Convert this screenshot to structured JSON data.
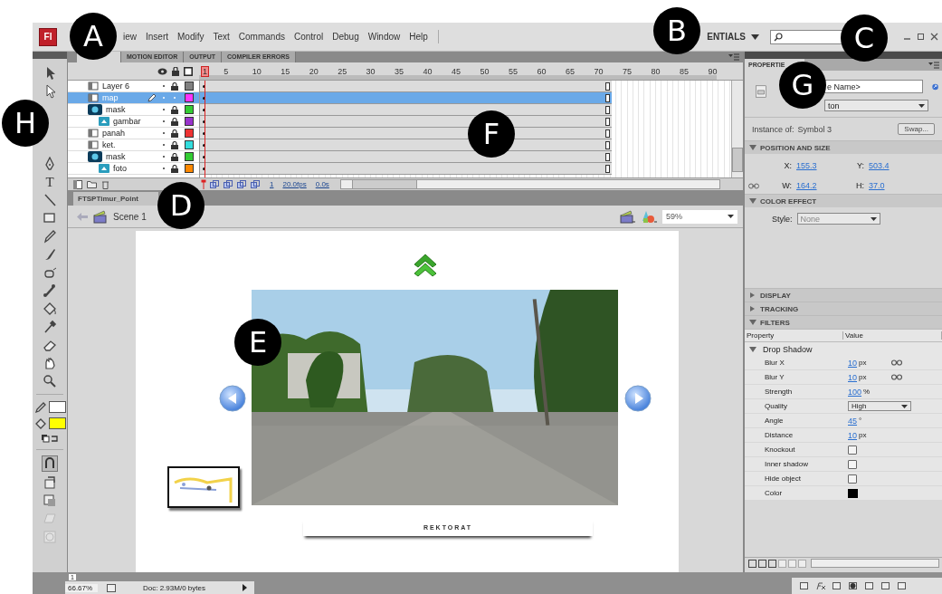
{
  "callouts": [
    "A",
    "B",
    "C",
    "D",
    "E",
    "F",
    "G",
    "H"
  ],
  "menu_bar": {
    "logo": "Fl",
    "items": [
      "iew",
      "Insert",
      "Modify",
      "Text",
      "Commands",
      "Control",
      "Debug",
      "Window",
      "Help"
    ],
    "workspace": "ENTIALS"
  },
  "tools": {
    "text_tool": "T",
    "swatches": [
      {
        "kind": "stroke",
        "color": "#ffffff"
      },
      {
        "kind": "fill",
        "color": "#ffff00"
      }
    ]
  },
  "timeline": {
    "tabs": [
      {
        "selected": true
      },
      {
        "label": "MOTION EDITOR",
        "selected": false
      },
      {
        "label": "OUTPUT",
        "selected": false
      },
      {
        "label": "COMPILER ERRORS",
        "selected": false
      }
    ],
    "ruler": [
      "1",
      "5",
      "10",
      "15",
      "20",
      "25",
      "30",
      "35",
      "40",
      "45",
      "50",
      "55",
      "60",
      "65",
      "70",
      "75",
      "80",
      "85",
      "90"
    ],
    "layers": [
      {
        "name": "Layer 6",
        "kind": "normal",
        "selected": false,
        "locked": true,
        "color": "#808080"
      },
      {
        "name": "map",
        "kind": "normal",
        "selected": true,
        "locked": false,
        "color": "#ff33ff"
      },
      {
        "name": "mask",
        "kind": "mask",
        "selected": false,
        "locked": true,
        "color": "#33cc33",
        "children": [
          {
            "name": "gambar",
            "kind": "masked",
            "selected": false,
            "locked": true,
            "color": "#9933cc"
          }
        ]
      },
      {
        "name": "panah",
        "kind": "normal",
        "selected": false,
        "locked": true,
        "color": "#ee3333"
      },
      {
        "name": "ket.",
        "kind": "normal",
        "selected": false,
        "locked": true,
        "color": "#33dddd"
      },
      {
        "name": "mask",
        "kind": "mask",
        "selected": false,
        "locked": true,
        "color": "#33cc33",
        "children": [
          {
            "name": "foto",
            "kind": "masked",
            "selected": false,
            "locked": true,
            "color": "#ff8800"
          }
        ]
      }
    ],
    "footer": {
      "frame": "1",
      "fps": "20.0fps",
      "time": "0.0s"
    }
  },
  "document": {
    "tab": "FTSPTimur_Point",
    "scene": "Scene 1",
    "zoom": "59%",
    "caption": "REKTORAT"
  },
  "properties": {
    "tab": "PROPERTIE",
    "instance_name": "e Name>",
    "behavior": "ton",
    "instance_of": "Instance of:",
    "symbol": "Symbol 3",
    "swap": "Swap...",
    "sections": [
      {
        "kind": "position",
        "title": "POSITION AND SIZE",
        "expanded": true,
        "fields": [
          {
            "label": "X:",
            "value": "155.3"
          },
          {
            "label": "Y:",
            "value": "503.4"
          },
          {
            "label": "W:",
            "value": "164.2"
          },
          {
            "label": "H:",
            "value": "37.0"
          }
        ]
      },
      {
        "kind": "color_effect",
        "title": "COLOR EFFECT",
        "expanded": true,
        "style_label": "Style:",
        "style": "None"
      },
      {
        "kind": "plain",
        "title": "DISPLAY",
        "expanded": false
      },
      {
        "kind": "plain",
        "title": "TRACKING",
        "expanded": false
      },
      {
        "kind": "filters",
        "title": "FILTERS",
        "expanded": true,
        "columns": [
          "Property",
          "Value"
        ],
        "filter": {
          "name": "Drop Shadow",
          "expanded": true,
          "rows": [
            {
              "kind": "number",
              "label": "Blur X",
              "value": "10",
              "unit": "px",
              "linked": true
            },
            {
              "kind": "number",
              "label": "Blur Y",
              "value": "10",
              "unit": "px",
              "linked": true
            },
            {
              "kind": "number",
              "label": "Strength",
              "value": "100",
              "unit": "%"
            },
            {
              "kind": "select",
              "label": "Quality",
              "value": "High"
            },
            {
              "kind": "number",
              "label": "Angle",
              "value": "45",
              "unit": "°"
            },
            {
              "kind": "number",
              "label": "Distance",
              "value": "10",
              "unit": "px"
            },
            {
              "kind": "check",
              "label": "Knockout",
              "checked": false
            },
            {
              "kind": "check",
              "label": "Inner shadow",
              "checked": false
            },
            {
              "kind": "check",
              "label": "Hide object",
              "checked": false
            },
            {
              "kind": "color",
              "label": "Color",
              "color": "#000000"
            }
          ]
        }
      }
    ]
  },
  "status_bar": {
    "frame": "1",
    "zoom": "66.67%",
    "doc": "Doc: 2.93M/0 bytes"
  }
}
